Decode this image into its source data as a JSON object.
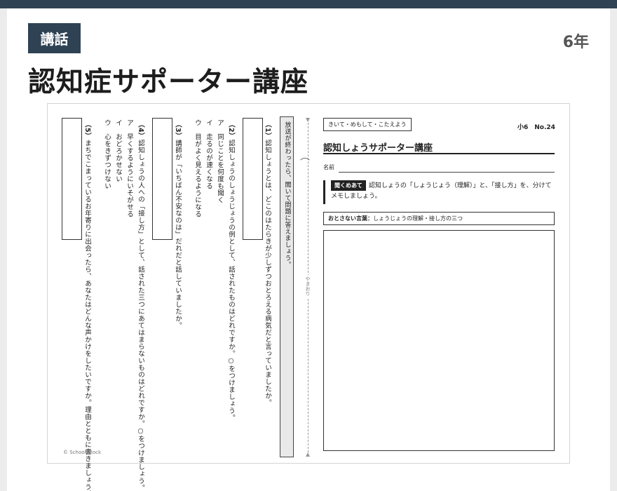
{
  "header": {
    "badge": "講話",
    "grade": "6年",
    "title": "認知症サポーター講座"
  },
  "worksheet": {
    "right": {
      "tag": "きいて・めもして・こたえよう",
      "grade_no": "小6　No.24",
      "title": "認知しょうサポーター講座",
      "name_label": "名前",
      "purpose_badge": "聞くめあて",
      "purpose_text": "認知しょうの「しょうじょう（理解）」と、「接し方」を、分けてメモしましょう。",
      "keyword_label": "おとさない言葉：",
      "keyword_text": "しょうじょうの理解・接し方の三つ"
    },
    "announce": "放送が終わったら、聞いて問題に答えましょう。",
    "fold_label": "やまおり",
    "questions": {
      "q1": {
        "num": "（1）",
        "text": "認知しょうとは、どこのはたらきが少しずつおとろえる病気だと言っていましたか。"
      },
      "q2": {
        "num": "（2）",
        "text": "認知しょうのしょうじょうの例として、話されたものはどれですか。○をつけましょう。",
        "options": [
          "ア　同じことを何度も聞く",
          "イ　走るのが速くなる",
          "ウ　目がよく見えるようになる"
        ]
      },
      "q3": {
        "num": "（3）",
        "text": "講師が「いちばん不安なのは」だれだと話していましたか。"
      },
      "q4": {
        "num": "（4）",
        "text": "認知しょうの人への「接し方」として、話された三つにあてはまらないものはどれですか。○をつけましょう。",
        "options": [
          "ア　早くするようにいそがせる",
          "イ　おどろかせない",
          "ウ　心をきずつけない"
        ]
      },
      "q5": {
        "num": "（5）",
        "text": "まちでこまっているお年寄りに出会ったら、あなたはどんな声かけをしたいですか。理由とともに書きましょう。"
      }
    },
    "copyright": "© School Stock"
  }
}
